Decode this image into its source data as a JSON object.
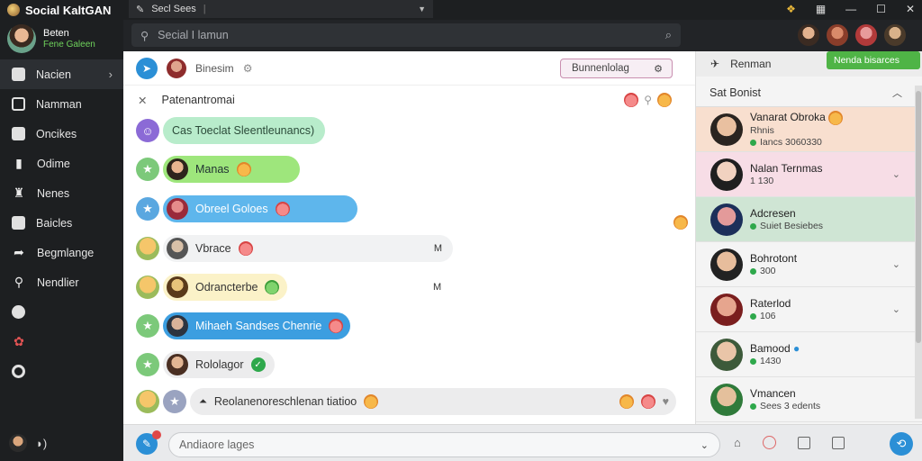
{
  "app": {
    "title": "Social KaltGAN"
  },
  "profile": {
    "name": "Beten",
    "status": "Fene Galeen"
  },
  "sidebar": {
    "items": [
      {
        "label": "Nacien",
        "icon": "home-icon"
      },
      {
        "label": "Namman",
        "icon": "inbox-icon"
      },
      {
        "label": "Oncikes",
        "icon": "folder-icon"
      },
      {
        "label": "Odime",
        "icon": "book-icon"
      },
      {
        "label": "Nenes",
        "icon": "people-icon"
      },
      {
        "label": "Baicles",
        "icon": "shield-icon"
      },
      {
        "label": "Begmlange",
        "icon": "share-icon"
      },
      {
        "label": "Nendlier",
        "icon": "search-icon"
      },
      {
        "label": "",
        "icon": "info-icon"
      },
      {
        "label": "",
        "icon": "flower-icon"
      },
      {
        "label": "",
        "icon": "power-icon"
      }
    ]
  },
  "topbar": {
    "tab_label": "Secl Sees"
  },
  "search": {
    "placeholder": "Secial I lamun"
  },
  "chat": {
    "contact_name": "Binesim",
    "action_button": "Bunnenlolag",
    "subheader": "Patenantromai",
    "messages": [
      {
        "text": "Cas Toeclat Sleentleunancs)"
      },
      {
        "text": "Manas"
      },
      {
        "text": "Obreel Goloes"
      },
      {
        "text": "Vbrace",
        "tail": "M"
      },
      {
        "text": "Odrancterbe",
        "tail": "M"
      },
      {
        "text": "Mihaeh Sandses Chenrie"
      },
      {
        "text": "Rololagor"
      },
      {
        "text": "Reolanenoreschlenan tiatioo"
      }
    ]
  },
  "composer": {
    "placeholder": "Andiaore lages"
  },
  "rightpanel": {
    "top_label": "Renman",
    "top_button": "Nenda bisarces",
    "section_title": "Sat Bonist",
    "contacts": [
      {
        "name": "Vanarat Obroka",
        "sub1": "Rhnis",
        "sub2": "Iancs 3060330"
      },
      {
        "name": "Nalan Ternmas",
        "sub1": "1 130"
      },
      {
        "name": "Adcresen",
        "sub1": "Suiet Besiebes"
      },
      {
        "name": "Bohrotont",
        "sub1": "300"
      },
      {
        "name": "Raterlod",
        "sub1": "106"
      },
      {
        "name": "Bamood",
        "sub1": "1430"
      },
      {
        "name": "Vmancen",
        "sub1": "Sees 3 edents"
      }
    ]
  },
  "colors": {
    "accent": "#2b8fd6",
    "sidebar_bg": "#1d1f21",
    "online": "#2ea84b"
  }
}
